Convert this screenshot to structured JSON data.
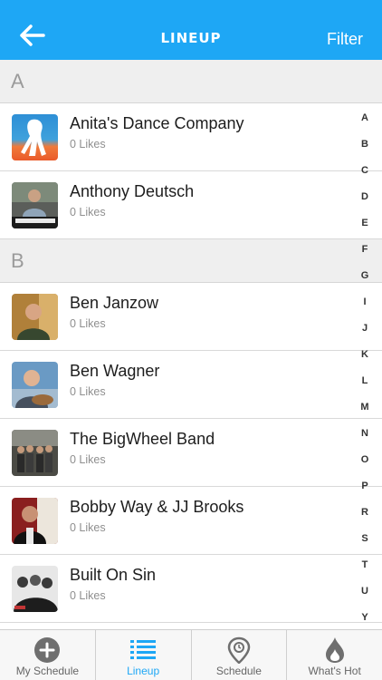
{
  "header": {
    "title": "LINEUP",
    "filter_label": "Filter"
  },
  "sections": [
    {
      "letter": "A",
      "artists": [
        {
          "name": "Anita's Dance Company",
          "likes": "0 Likes",
          "thumb": "dancer-logo"
        },
        {
          "name": "Anthony Deutsch",
          "likes": "0 Likes",
          "thumb": "pianist-photo"
        }
      ]
    },
    {
      "letter": "B",
      "artists": [
        {
          "name": "Ben Janzow",
          "likes": "0 Likes",
          "thumb": "portrait-photo"
        },
        {
          "name": "Ben Wagner",
          "likes": "0 Likes",
          "thumb": "guitarist-photo"
        },
        {
          "name": "The BigWheel Band",
          "likes": "0 Likes",
          "thumb": "band-photo"
        },
        {
          "name": "Bobby Way & JJ Brooks",
          "likes": "0 Likes",
          "thumb": "duo-photo"
        },
        {
          "name": "Built On Sin",
          "likes": "0 Likes",
          "thumb": "bw-band-photo"
        }
      ]
    }
  ],
  "index_letters": [
    "A",
    "B",
    "C",
    "D",
    "E",
    "F",
    "G",
    "I",
    "J",
    "K",
    "L",
    "M",
    "N",
    "O",
    "P",
    "R",
    "S",
    "T",
    "U",
    "Y"
  ],
  "tabs": [
    {
      "label": "My Schedule",
      "icon": "plus-circle-icon",
      "active": false
    },
    {
      "label": "Lineup",
      "icon": "list-icon",
      "active": true
    },
    {
      "label": "Schedule",
      "icon": "map-pin-icon",
      "active": false
    },
    {
      "label": "What's Hot",
      "icon": "flame-icon",
      "active": false
    }
  ],
  "colors": {
    "accent": "#1ea7f5",
    "tab_icon": "#6f6f6f",
    "section_bg": "#efefef"
  }
}
